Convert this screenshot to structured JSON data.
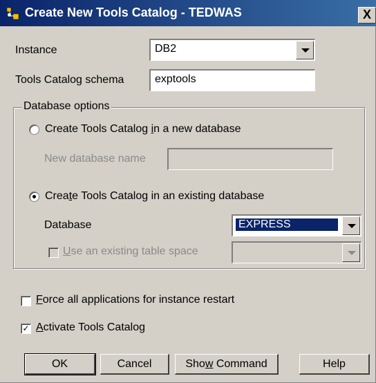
{
  "window": {
    "title": "Create New Tools Catalog - TEDWAS",
    "close_label": "X"
  },
  "instance": {
    "label": "Instance",
    "value": "DB2"
  },
  "schema": {
    "label": "Tools Catalog schema",
    "value": "exptools"
  },
  "db_options": {
    "group_title": "Database options",
    "new_db": {
      "label_pre": "Create Tools Catalog ",
      "label_mn": "i",
      "label_post": "n a new database",
      "checked": false
    },
    "new_db_name": {
      "label": "New database name",
      "value": ""
    },
    "existing_db": {
      "label_pre": "Crea",
      "label_mn": "t",
      "label_post": "e Tools Catalog in an existing database",
      "checked": true
    },
    "database": {
      "label": "Database",
      "value": "EXPRESS"
    },
    "use_ts": {
      "label_mn": "U",
      "label_post": "se an existing table space",
      "checked": false
    },
    "table_space": {
      "value": ""
    }
  },
  "force": {
    "label_mn": "F",
    "label_post": "orce all applications for instance restart",
    "checked": false
  },
  "activate": {
    "label_mn": "A",
    "label_post": "ctivate Tools Catalog",
    "checked": true
  },
  "buttons": {
    "ok": "OK",
    "cancel": "Cancel",
    "show_pre": "Sho",
    "show_mn": "w",
    "show_post": " Command",
    "help": "Help"
  },
  "colors": {
    "title_bar": "#0a246a",
    "dialog_bg": "#d4d0c8",
    "highlight": "#0a246a"
  }
}
